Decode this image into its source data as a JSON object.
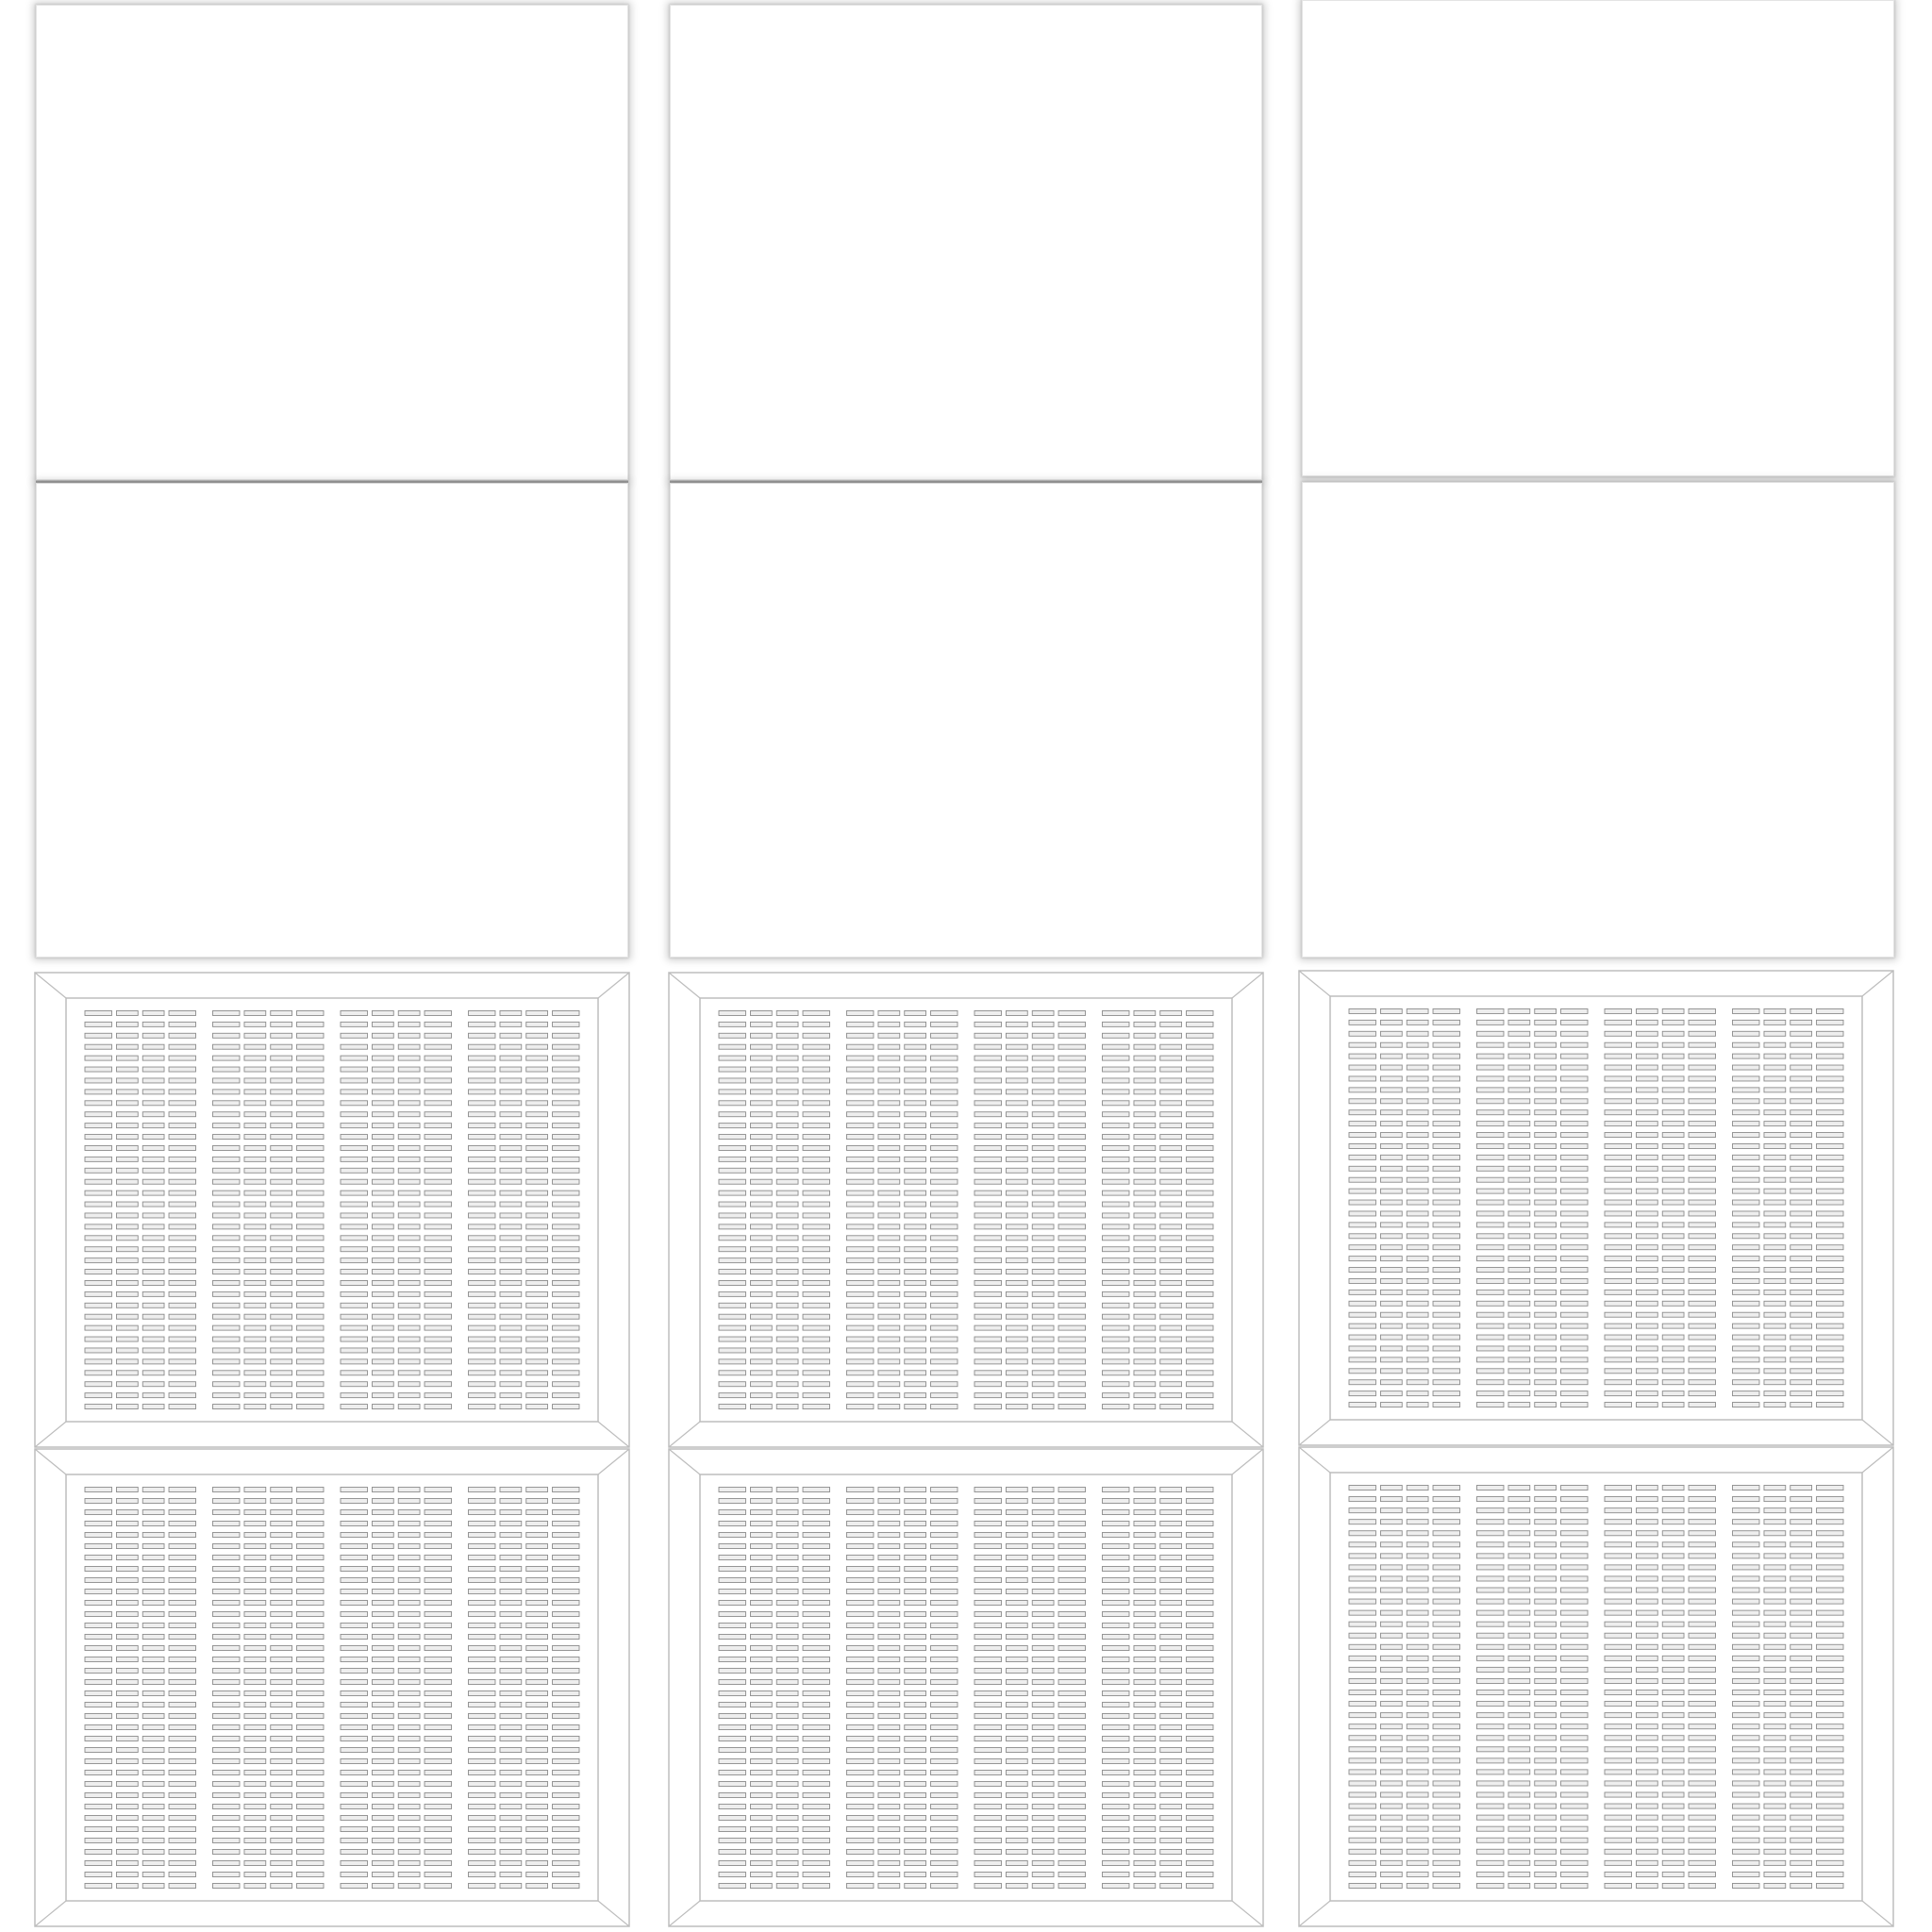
{
  "grid": {
    "panel_columns": 3,
    "panel_rows": 4,
    "blank_panel_rows": 2,
    "slot_panel_rows": 2
  },
  "slot_panel": {
    "groups": 4,
    "slots_per_group": 4,
    "slot_rows": 36
  },
  "colors": {
    "background": "#ffffff",
    "panel_border": "#e4e4e4",
    "frame_line": "#bdbdbd",
    "slot_fill": "#eeeeee",
    "slot_stroke": "#8c8c8c"
  }
}
